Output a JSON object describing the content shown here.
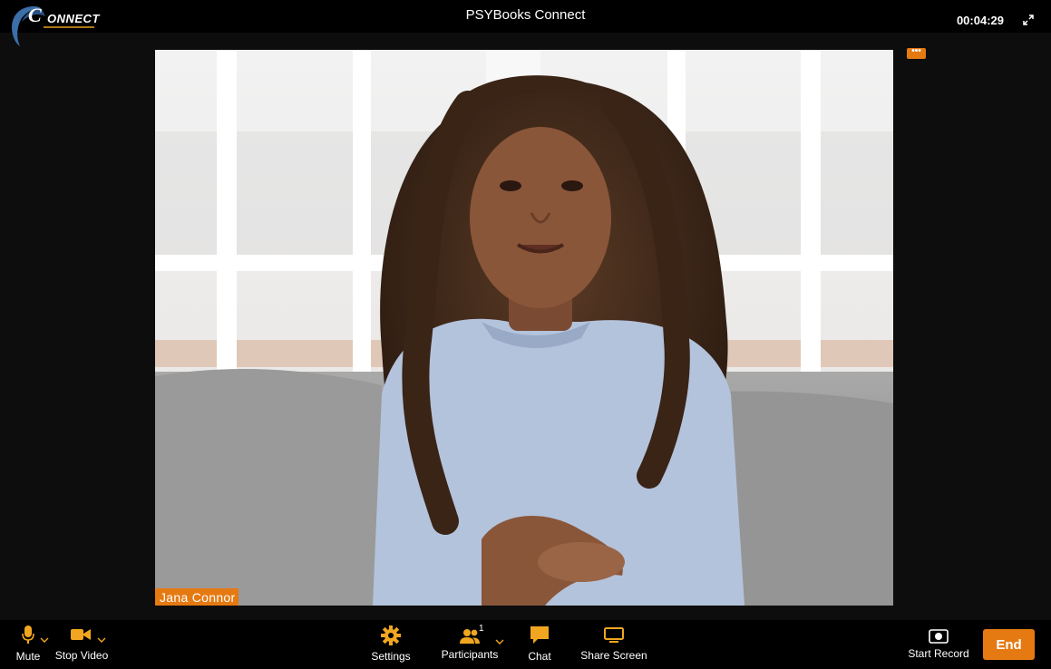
{
  "app": {
    "title": "PSYBooks Connect",
    "logo_text": "ONNECT",
    "logo_letter": "C",
    "timer": "00:04:29"
  },
  "video": {
    "participant_name": "Jana Connor",
    "more_label": "•••"
  },
  "toolbar": {
    "mute_label": "Mute",
    "stop_video_label": "Stop Video",
    "settings_label": "Settings",
    "participants_label": "Participants",
    "participants_count": "1",
    "chat_label": "Chat",
    "share_screen_label": "Share Screen",
    "start_record_label": "Start Record",
    "end_label": "End"
  },
  "colors": {
    "accent": "#e57a13",
    "icon": "#f0a620",
    "background": "#0d0d0d",
    "bar": "#000000"
  },
  "icons": [
    "microphone-icon",
    "video-camera-icon",
    "gear-icon",
    "participants-icon",
    "chat-bubble-icon",
    "share-screen-icon",
    "record-icon",
    "expand-icon",
    "chevron-down-icon"
  ]
}
